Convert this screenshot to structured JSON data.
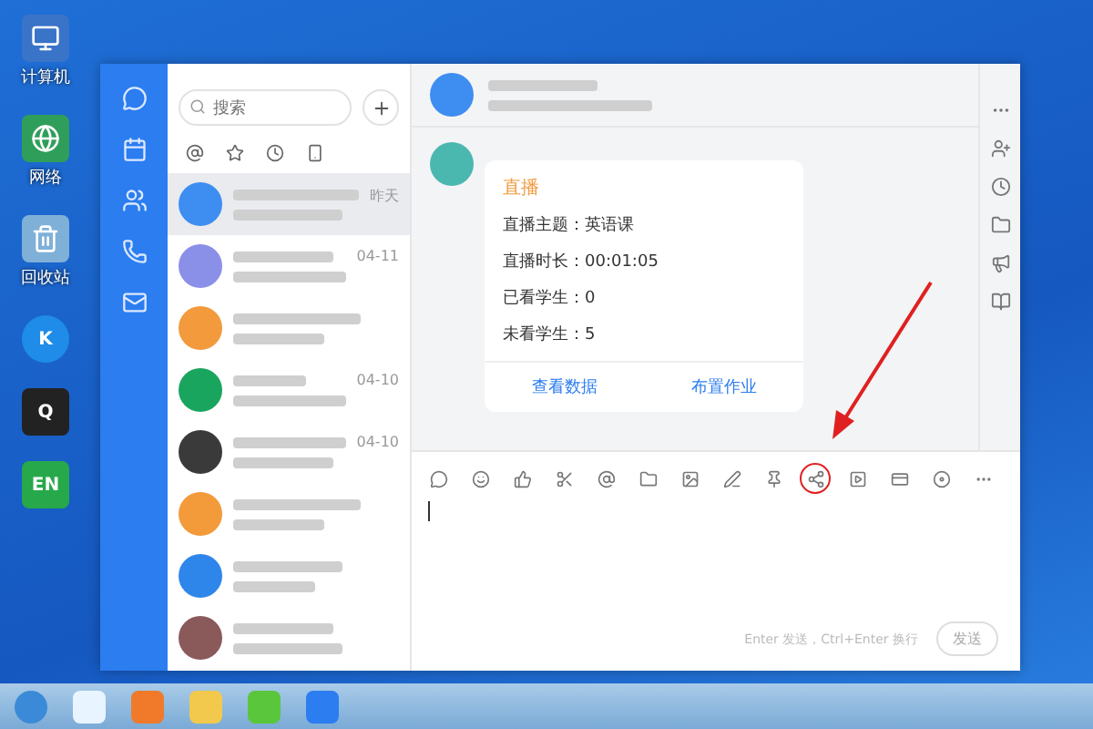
{
  "desktop_icons": [
    {
      "kind": "computer",
      "label": "计算机"
    },
    {
      "kind": "network",
      "label": "网络"
    },
    {
      "kind": "trash",
      "label": "回收站"
    },
    {
      "kind": "k-app",
      "glyph": "K"
    },
    {
      "kind": "penguin",
      "glyph": "Q"
    },
    {
      "kind": "en-app",
      "glyph": "EN"
    }
  ],
  "search": {
    "placeholder": "搜索"
  },
  "filters": [
    {
      "kind": "at",
      "selected": false
    },
    {
      "kind": "star",
      "selected": false
    },
    {
      "kind": "clock",
      "selected": false
    },
    {
      "kind": "phone",
      "selected": false
    }
  ],
  "conversations": [
    {
      "time": "昨天",
      "color": "#3d8ef0",
      "selected": true
    },
    {
      "time": "04-11",
      "color": "#8a8fe8",
      "selected": false
    },
    {
      "color": "#f29a3c",
      "selected": false
    },
    {
      "time": "04-10",
      "color": "#1aa55f",
      "selected": false
    },
    {
      "time": "04-10",
      "color": "#3a3a3a",
      "selected": false
    },
    {
      "color": "#f39a3a",
      "selected": false
    },
    {
      "color": "#2f86ea",
      "selected": false
    },
    {
      "color": "#8a5a5a",
      "selected": false
    }
  ],
  "card": {
    "title": "直播",
    "lines": [
      "直播主题：英语课",
      "直播时长：00:01:05",
      "已看学生：0",
      "未看学生：5"
    ],
    "actions": [
      "查看数据",
      "布置作业"
    ]
  },
  "tools": [
    {
      "kind": "ding",
      "circled": false
    },
    {
      "kind": "smile",
      "circled": false
    },
    {
      "kind": "thumb",
      "circled": false
    },
    {
      "kind": "scissors",
      "circled": false
    },
    {
      "kind": "at",
      "circled": false
    },
    {
      "kind": "folder",
      "circled": false
    },
    {
      "kind": "image",
      "circled": false
    },
    {
      "kind": "edit",
      "circled": false
    },
    {
      "kind": "pin",
      "circled": false
    },
    {
      "kind": "live",
      "circled": true
    },
    {
      "kind": "video",
      "circled": false
    },
    {
      "kind": "card",
      "circled": false
    },
    {
      "kind": "record",
      "circled": false
    },
    {
      "kind": "more",
      "circled": false
    }
  ],
  "input": {
    "hint": "Enter 发送，Ctrl+Enter 换行"
  },
  "send_button": "发送"
}
